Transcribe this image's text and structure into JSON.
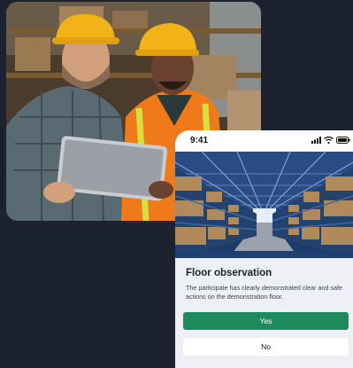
{
  "photo": {
    "icon": "workers-photo"
  },
  "phone": {
    "status_time": "9:41",
    "status_icons": [
      "signal-icon",
      "wifi-icon",
      "battery-icon"
    ],
    "hero_image": "warehouse-photo",
    "title": "Floor observation",
    "description": "The participate has clearly demonstrated clear and safe actions on the demonstration floor.",
    "yes_label": "Yes",
    "no_label": "No"
  },
  "colors": {
    "background": "#1d2230",
    "yes_button": "#1f8a5e",
    "card": "#eef0f6"
  }
}
